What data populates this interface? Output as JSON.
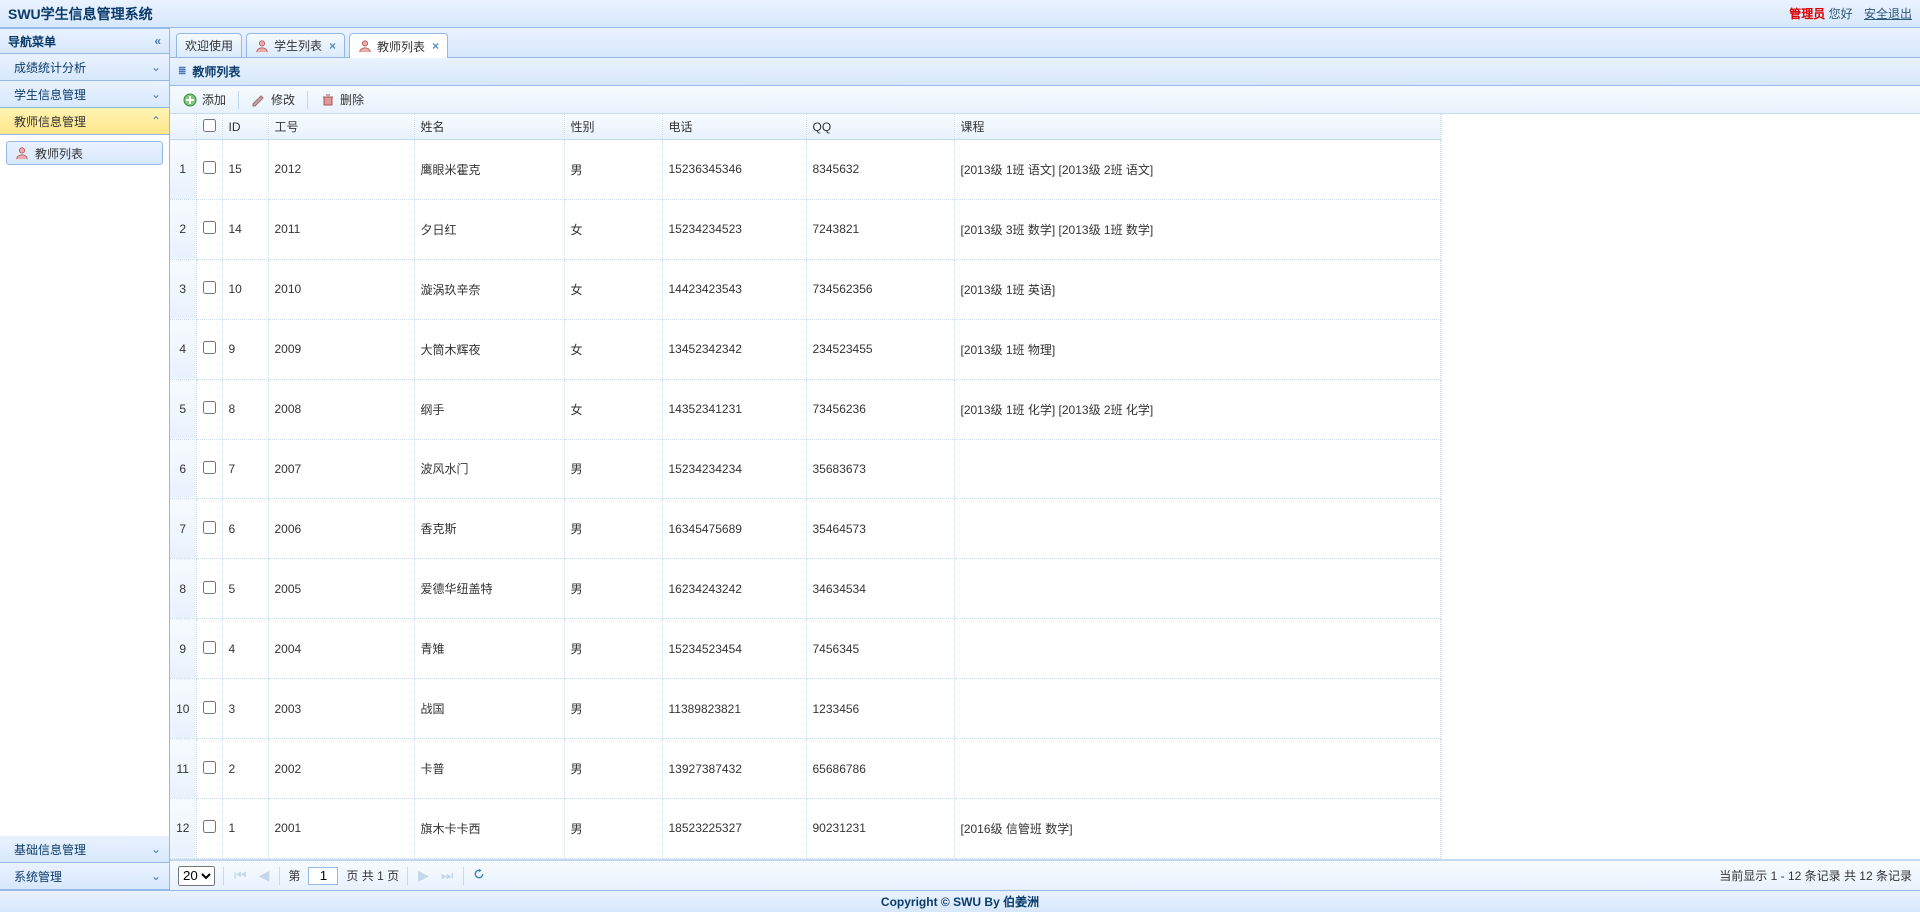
{
  "header": {
    "app_title": "SWU学生信息管理系统",
    "admin_label": "管理员",
    "hello_label": "您好",
    "logout_label": "安全退出"
  },
  "sidebar": {
    "title": "导航菜单",
    "items": [
      {
        "label": "成绩统计分析",
        "expanded": false,
        "active": false
      },
      {
        "label": "学生信息管理",
        "expanded": false,
        "active": false
      },
      {
        "label": "教师信息管理",
        "expanded": true,
        "active": true,
        "children": [
          {
            "label": "教师列表"
          }
        ]
      },
      {
        "label": "基础信息管理",
        "expanded": false,
        "active": false
      },
      {
        "label": "系统管理",
        "expanded": false,
        "active": false
      }
    ]
  },
  "tabs": [
    {
      "label": "欢迎使用",
      "closable": false,
      "icon": false
    },
    {
      "label": "学生列表",
      "closable": true,
      "icon": true
    },
    {
      "label": "教师列表",
      "closable": true,
      "icon": true,
      "active": true
    }
  ],
  "panel": {
    "title": "教师列表"
  },
  "toolbar": {
    "add_label": "添加",
    "edit_label": "修改",
    "delete_label": "删除"
  },
  "grid": {
    "columns": {
      "id": "ID",
      "no": "工号",
      "name": "姓名",
      "gender": "性别",
      "phone": "电话",
      "qq": "QQ",
      "course": "课程"
    },
    "rows": [
      {
        "n": "1",
        "id": "15",
        "no": "2012",
        "name": "鹰眼米霍克",
        "gender": "男",
        "phone": "15236345346",
        "qq": "8345632",
        "course": "[2013级 1班 语文]     [2013级 2班 语文]"
      },
      {
        "n": "2",
        "id": "14",
        "no": "2011",
        "name": "夕日红",
        "gender": "女",
        "phone": "15234234523",
        "qq": "7243821",
        "course": "[2013级 3班 数学]     [2013级 1班 数学]"
      },
      {
        "n": "3",
        "id": "10",
        "no": "2010",
        "name": "漩涡玖辛奈",
        "gender": "女",
        "phone": "14423423543",
        "qq": "734562356",
        "course": "[2013级 1班 英语]"
      },
      {
        "n": "4",
        "id": "9",
        "no": "2009",
        "name": "大筒木辉夜",
        "gender": "女",
        "phone": "13452342342",
        "qq": "234523455",
        "course": "[2013级 1班 物理]"
      },
      {
        "n": "5",
        "id": "8",
        "no": "2008",
        "name": "纲手",
        "gender": "女",
        "phone": "14352341231",
        "qq": "73456236",
        "course": "[2013级 1班 化学]     [2013级 2班 化学]"
      },
      {
        "n": "6",
        "id": "7",
        "no": "2007",
        "name": "波风水门",
        "gender": "男",
        "phone": "15234234234",
        "qq": "35683673",
        "course": ""
      },
      {
        "n": "7",
        "id": "6",
        "no": "2006",
        "name": "香克斯",
        "gender": "男",
        "phone": "16345475689",
        "qq": "35464573",
        "course": ""
      },
      {
        "n": "8",
        "id": "5",
        "no": "2005",
        "name": "爱德华纽盖特",
        "gender": "男",
        "phone": "16234243242",
        "qq": "34634534",
        "course": ""
      },
      {
        "n": "9",
        "id": "4",
        "no": "2004",
        "name": "青雉",
        "gender": "男",
        "phone": "15234523454",
        "qq": "7456345",
        "course": ""
      },
      {
        "n": "10",
        "id": "3",
        "no": "2003",
        "name": "战国",
        "gender": "男",
        "phone": "11389823821",
        "qq": "1233456",
        "course": ""
      },
      {
        "n": "11",
        "id": "2",
        "no": "2002",
        "name": "卡普",
        "gender": "男",
        "phone": "13927387432",
        "qq": "65686786",
        "course": ""
      },
      {
        "n": "12",
        "id": "1",
        "no": "2001",
        "name": "旗木卡卡西",
        "gender": "男",
        "phone": "18523225327",
        "qq": "90231231",
        "course": "[2016级 信管班 数学]"
      }
    ]
  },
  "pager": {
    "page_size": "20",
    "page_label_prefix": "第",
    "page_value": "1",
    "page_label_suffix": "页 共 1 页",
    "info": "当前显示 1 - 12 条记录 共 12 条记录"
  },
  "footer": {
    "text": "Copyright © SWU By 伯姜洲"
  }
}
